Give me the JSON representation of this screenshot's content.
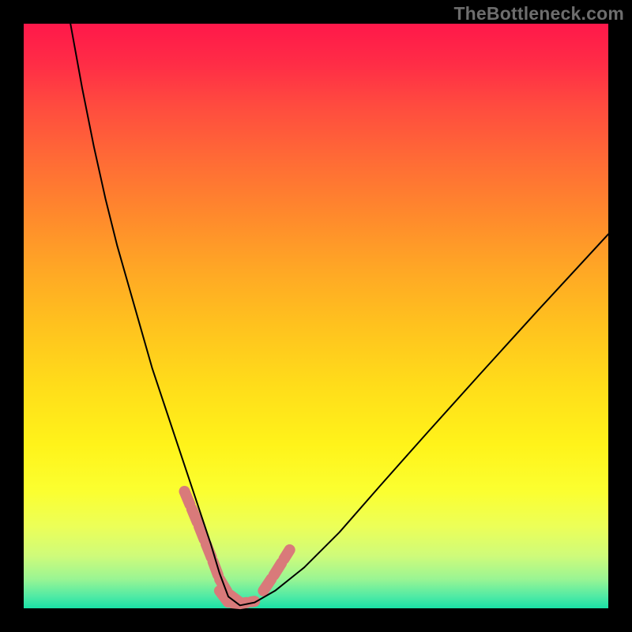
{
  "watermark": "TheBottleneck.com",
  "chart_data": {
    "type": "line",
    "title": "",
    "xlabel": "",
    "ylabel": "",
    "xlim": [
      0,
      100
    ],
    "ylim": [
      0,
      100
    ],
    "grid": false,
    "series": [
      {
        "name": "bottleneck-curve",
        "x": [
          8,
          10,
          12,
          14,
          16,
          18,
          20,
          22,
          24,
          26,
          28,
          30,
          32,
          33.5,
          35,
          37,
          39.5,
          43,
          48,
          54,
          61,
          69,
          78,
          88,
          100
        ],
        "y": [
          100,
          89,
          79,
          70,
          62,
          55,
          48,
          41,
          35,
          29,
          23,
          17,
          11,
          6,
          2,
          0.5,
          1,
          3,
          7,
          13,
          21,
          30,
          40,
          51,
          64
        ],
        "color": "#000000",
        "width": 2
      },
      {
        "name": "highlight-segment-left",
        "x": [
          27.5,
          30,
          32,
          33.5,
          35,
          37
        ],
        "y": [
          20,
          14,
          9,
          5,
          2.5,
          1
        ],
        "color": "#d97a7a",
        "width": 14
      },
      {
        "name": "highlight-segment-bottom",
        "x": [
          33.5,
          35,
          37,
          39.5
        ],
        "y": [
          3,
          1,
          0.8,
          1.2
        ],
        "color": "#d97a7a",
        "width": 14
      },
      {
        "name": "highlight-segment-right",
        "x": [
          41,
          43,
          45.5
        ],
        "y": [
          3,
          6,
          10
        ],
        "color": "#d97a7a",
        "width": 14
      }
    ],
    "annotations": []
  },
  "colors": {
    "frame": "#000000",
    "watermark": "#6d6d6d",
    "highlight": "#d97a7a",
    "curve": "#000000"
  }
}
